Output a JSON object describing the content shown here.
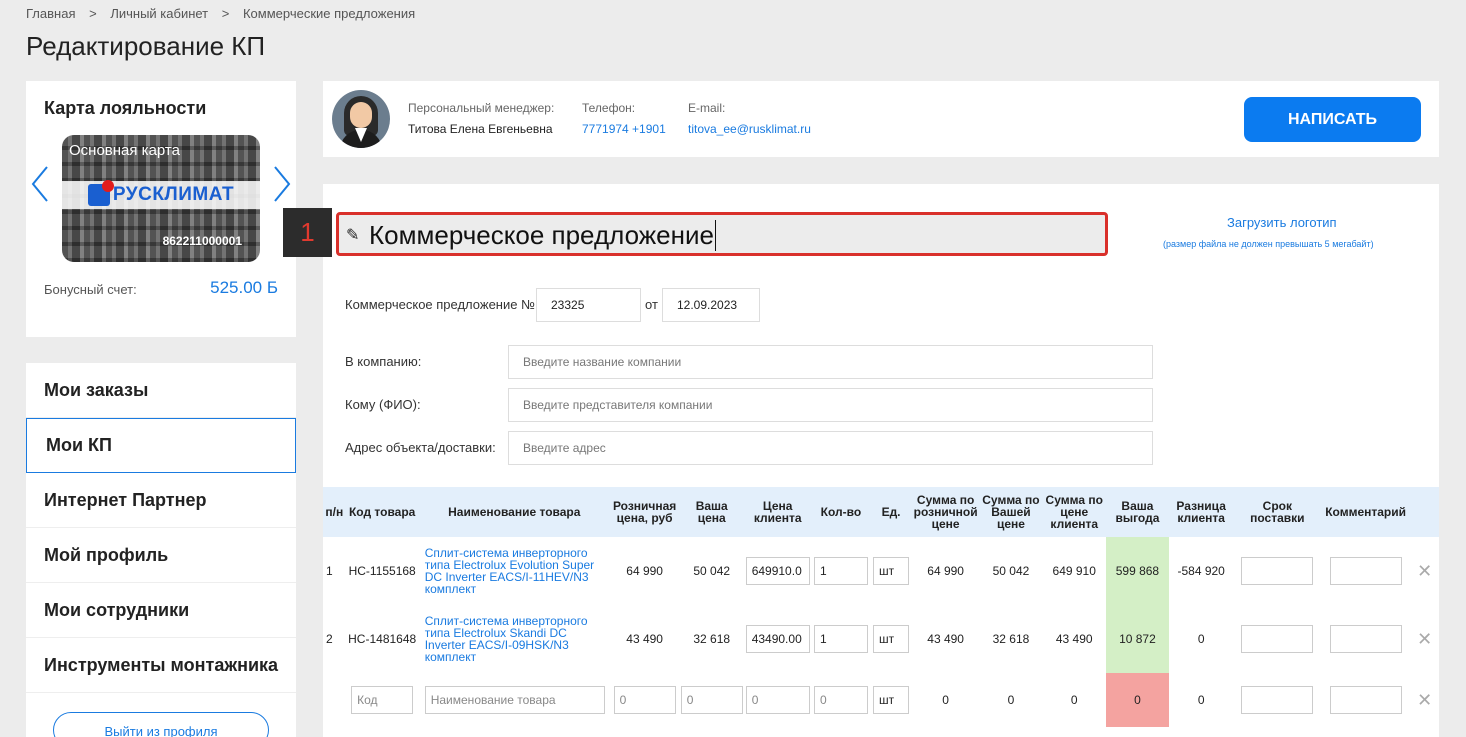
{
  "breadcrumb": [
    "Главная",
    ">",
    "Личный кабинет",
    ">",
    "Коммерческие предложения"
  ],
  "page_title": "Редактирование КП",
  "loyalty": {
    "title": "Карта лояльности",
    "card_title": "Основная карта",
    "card_brand": "РУСКЛИМАТ",
    "card_number": "862211000001",
    "bonus_label": "Бонусный счет:",
    "bonus_value": "525.00 Б"
  },
  "menu": {
    "items": [
      "Мои заказы",
      "Мои КП",
      "Интернет Партнер",
      "Мой профиль",
      "Мои сотрудники",
      "Инструменты монтажника"
    ],
    "active": "Мои КП",
    "logout": "Выйти из профиля"
  },
  "manager": {
    "role_label": "Персональный менеджер:",
    "name": "Титова Елена Евгеньевна",
    "phone_label": "Телефон:",
    "phone": "7771974 +1901",
    "email_label": "E-mail:",
    "email": "titova_ee@rusklimat.ru",
    "write_button": "НАПИСАТЬ"
  },
  "kp": {
    "step": "1",
    "title": "Коммерческое предложение",
    "upload_logo": "Загрузить логотип",
    "upload_note": "(размер файла не должен превышать 5 мегабайт)",
    "number_label": "Коммерческое предложение №",
    "number": "23325",
    "from_label": "от",
    "date": "12.09.2023",
    "company_label": "В компанию:",
    "company_placeholder": "Введите название компании",
    "to_label": "Кому (ФИО):",
    "to_placeholder": "Введите представителя компании",
    "address_label": "Адрес объекта/доставки:",
    "address_placeholder": "Введите адрес"
  },
  "table": {
    "headers": [
      "п/н",
      "Код товара",
      "Наименование товара",
      "Розничная цена, руб",
      "Ваша цена",
      "Цена клиента",
      "Кол-во",
      "Ед.",
      "Сумма по розничной цене",
      "Сумма по Вашей цене",
      "Сумма по цене клиента",
      "Ваша выгода",
      "Разница клиента",
      "Срок поставки",
      "Комментарий"
    ],
    "rows": [
      {
        "n": "1",
        "code": "НС-1155168",
        "name": "Сплит-система инверторного типа Electrolux Evolution Super DC Inverter EACS/I-11HEV/N3 комплект",
        "retail": "64 990",
        "your": "50 042",
        "client_price": "649910.0",
        "qty": "1",
        "unit": "шт",
        "sum_retail": "64 990",
        "sum_your": "50 042",
        "sum_client": "649 910",
        "benefit": "599 868",
        "diff": "-584 920"
      },
      {
        "n": "2",
        "code": "НС-1481648",
        "name": "Сплит-система инверторного типа Electrolux Skandi DC Inverter EACS/I-09HSK/N3 комплект",
        "retail": "43 490",
        "your": "32 618",
        "client_price": "43490.00",
        "qty": "1",
        "unit": "шт",
        "sum_retail": "43 490",
        "sum_your": "32 618",
        "sum_client": "43 490",
        "benefit": "10 872",
        "diff": "0"
      }
    ],
    "new_row": {
      "code_placeholder": "Код",
      "name_placeholder": "Наименование товара",
      "retail": "0",
      "your": "0",
      "client_price": "0",
      "qty": "0",
      "unit": "шт",
      "sum_retail": "0",
      "sum_your": "0",
      "sum_client": "0",
      "benefit": "0",
      "diff": "0"
    }
  },
  "colors": {
    "accent": "#1a7be0",
    "button": "#0b7bf0",
    "highlight_border": "#d9302b",
    "benefit_positive": "#d4efc6",
    "benefit_zero": "#f4a3a0"
  }
}
